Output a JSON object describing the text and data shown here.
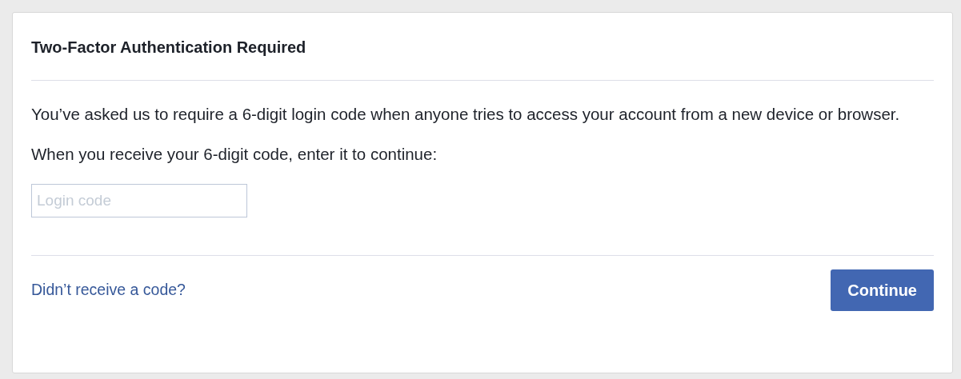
{
  "dialog": {
    "title": "Two-Factor Authentication Required",
    "message": "You’ve asked us to require a 6-digit login code when anyone tries to access your account from a new device or browser.",
    "instruction": "When you receive your 6-digit code, enter it to continue:",
    "code_field": {
      "placeholder": "Login code"
    },
    "help_link": "Didn’t receive a code?",
    "buttons": [
      "Continue"
    ]
  }
}
